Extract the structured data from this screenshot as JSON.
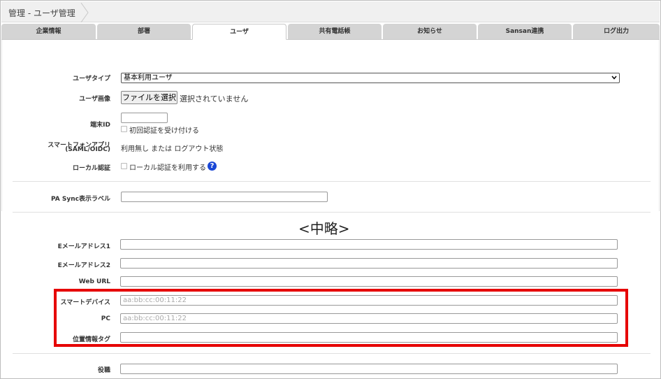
{
  "breadcrumb": {
    "text": "管理 - ユーザ管理"
  },
  "tabs": [
    {
      "label": "企業情報"
    },
    {
      "label": "部署"
    },
    {
      "label": "ユーザ"
    },
    {
      "label": "共有電話帳"
    },
    {
      "label": "お知らせ"
    },
    {
      "label": "Sansan連携"
    },
    {
      "label": "ログ出力"
    }
  ],
  "form": {
    "user_type": {
      "label": "ユーザタイプ",
      "value": "基本利用ユーザ"
    },
    "user_image": {
      "label": "ユーザ画像",
      "button": "ファイルを選択",
      "status": "選択されていません"
    },
    "terminal_id": {
      "label": "端末ID",
      "value": "",
      "checkbox_label": "初回認証を受け付ける"
    },
    "smartphone_app": {
      "label_line1": "スマートフォンアプリ",
      "label_line2": "(SAML/OIDC)",
      "value": "利用無し または ログアウト状態"
    },
    "local_auth": {
      "label": "ローカル認証",
      "checkbox_label": "ローカル認証を利用する",
      "help": "?"
    },
    "pa_sync": {
      "label": "PA Sync表示ラベル",
      "value": ""
    },
    "omitted": "<中略>",
    "email1": {
      "label": "Eメールアドレス1",
      "value": ""
    },
    "email2": {
      "label": "Eメールアドレス2",
      "value": ""
    },
    "web_url": {
      "label": "Web URL",
      "value": ""
    },
    "smart_device": {
      "label": "スマートデバイス",
      "placeholder": "aa:bb:cc:00:11:22"
    },
    "pc": {
      "label": "PC",
      "placeholder": "aa:bb:cc:00:11:22"
    },
    "location_tag": {
      "label": "位置情報タグ",
      "value": ""
    },
    "position": {
      "label": "役職",
      "value": ""
    }
  },
  "colors": {
    "highlight": "#e60000",
    "help_icon": "#1a47d6",
    "tab_inactive": "#d4d4d4"
  },
  "icons": {
    "help": "question-circle-icon",
    "select": "chevron-down-icon"
  }
}
